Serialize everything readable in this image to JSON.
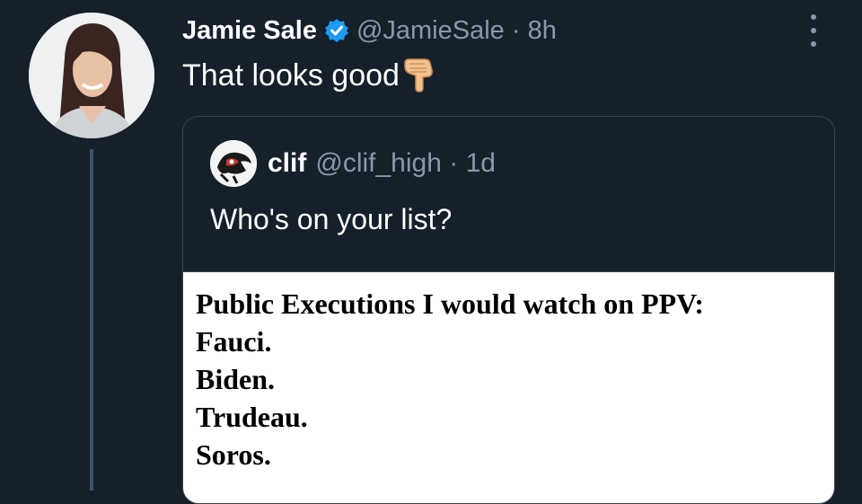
{
  "tweet": {
    "author_name": "Jamie Sale",
    "author_handle": "@JamieSale",
    "separator": "·",
    "time": "8h",
    "text": "That looks good",
    "emoji_icon": "backhand-index-pointing-down-icon"
  },
  "quoted_tweet": {
    "author_name": "clif",
    "author_handle": "@clif_high",
    "separator": "·",
    "time": "1d",
    "text": "Who's on your list?",
    "image_text": {
      "title": "Public Executions I would watch on PPV:",
      "lines": [
        "Fauci.",
        "Biden.",
        "Trudeau.",
        "Soros."
      ]
    }
  },
  "colors": {
    "background": "#15202b",
    "verified": "#1d9bf0",
    "muted_text": "#8b98a5",
    "thread_line": "#3d5466"
  }
}
